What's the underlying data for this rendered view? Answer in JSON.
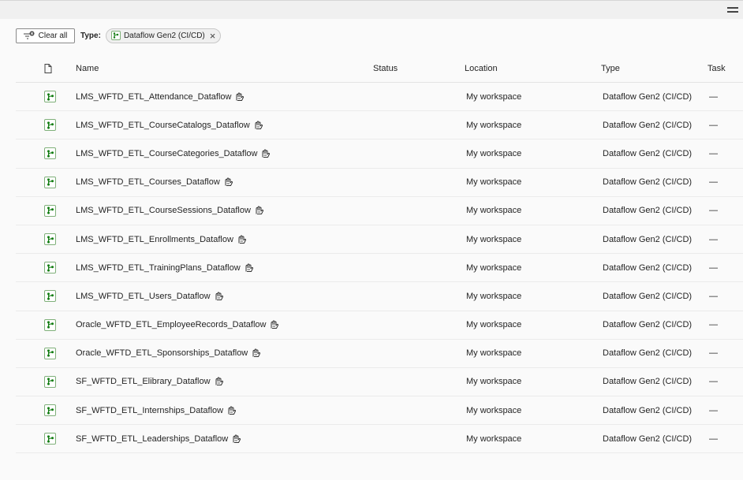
{
  "toolbar": {
    "menu_icon": "hamburger-icon"
  },
  "filters": {
    "clear_all_label": "Clear all",
    "type_label": "Type:",
    "chip_label": "Dataflow Gen2 (CI/CD)",
    "chip_close": "×"
  },
  "table": {
    "headers": {
      "icon": "file-icon",
      "name": "Name",
      "status": "Status",
      "location": "Location",
      "type": "Type",
      "task": "Task"
    },
    "rows": [
      {
        "name": "LMS_WFTD_ETL_Attendance_Dataflow",
        "status": "",
        "location": "My workspace",
        "type": "Dataflow Gen2 (CI/CD)",
        "task": "—"
      },
      {
        "name": "LMS_WFTD_ETL_CourseCatalogs_Dataflow",
        "status": "",
        "location": "My workspace",
        "type": "Dataflow Gen2 (CI/CD)",
        "task": "—"
      },
      {
        "name": "LMS_WFTD_ETL_CourseCategories_Dataflow",
        "status": "",
        "location": "My workspace",
        "type": "Dataflow Gen2 (CI/CD)",
        "task": "—"
      },
      {
        "name": "LMS_WFTD_ETL_Courses_Dataflow",
        "status": "",
        "location": "My workspace",
        "type": "Dataflow Gen2 (CI/CD)",
        "task": "—"
      },
      {
        "name": "LMS_WFTD_ETL_CourseSessions_Dataflow",
        "status": "",
        "location": "My workspace",
        "type": "Dataflow Gen2 (CI/CD)",
        "task": "—"
      },
      {
        "name": "LMS_WFTD_ETL_Enrollments_Dataflow",
        "status": "",
        "location": "My workspace",
        "type": "Dataflow Gen2 (CI/CD)",
        "task": "—"
      },
      {
        "name": "LMS_WFTD_ETL_TrainingPlans_Dataflow",
        "status": "",
        "location": "My workspace",
        "type": "Dataflow Gen2 (CI/CD)",
        "task": "—"
      },
      {
        "name": "LMS_WFTD_ETL_Users_Dataflow",
        "status": "",
        "location": "My workspace",
        "type": "Dataflow Gen2 (CI/CD)",
        "task": "—"
      },
      {
        "name": "Oracle_WFTD_ETL_EmployeeRecords_Dataflow",
        "status": "",
        "location": "My workspace",
        "type": "Dataflow Gen2 (CI/CD)",
        "task": "—"
      },
      {
        "name": "Oracle_WFTD_ETL_Sponsorships_Dataflow",
        "status": "",
        "location": "My workspace",
        "type": "Dataflow Gen2 (CI/CD)",
        "task": "—"
      },
      {
        "name": "SF_WFTD_ETL_Elibrary_Dataflow",
        "status": "",
        "location": "My workspace",
        "type": "Dataflow Gen2 (CI/CD)",
        "task": "—"
      },
      {
        "name": "SF_WFTD_ETL_Internships_Dataflow",
        "status": "",
        "location": "My workspace",
        "type": "Dataflow Gen2 (CI/CD)",
        "task": "—"
      },
      {
        "name": "SF_WFTD_ETL_Leaderships_Dataflow",
        "status": "",
        "location": "My workspace",
        "type": "Dataflow Gen2 (CI/CD)",
        "task": "—"
      }
    ]
  },
  "colors": {
    "accent": "#107c10",
    "border": "#8a8a8a"
  }
}
